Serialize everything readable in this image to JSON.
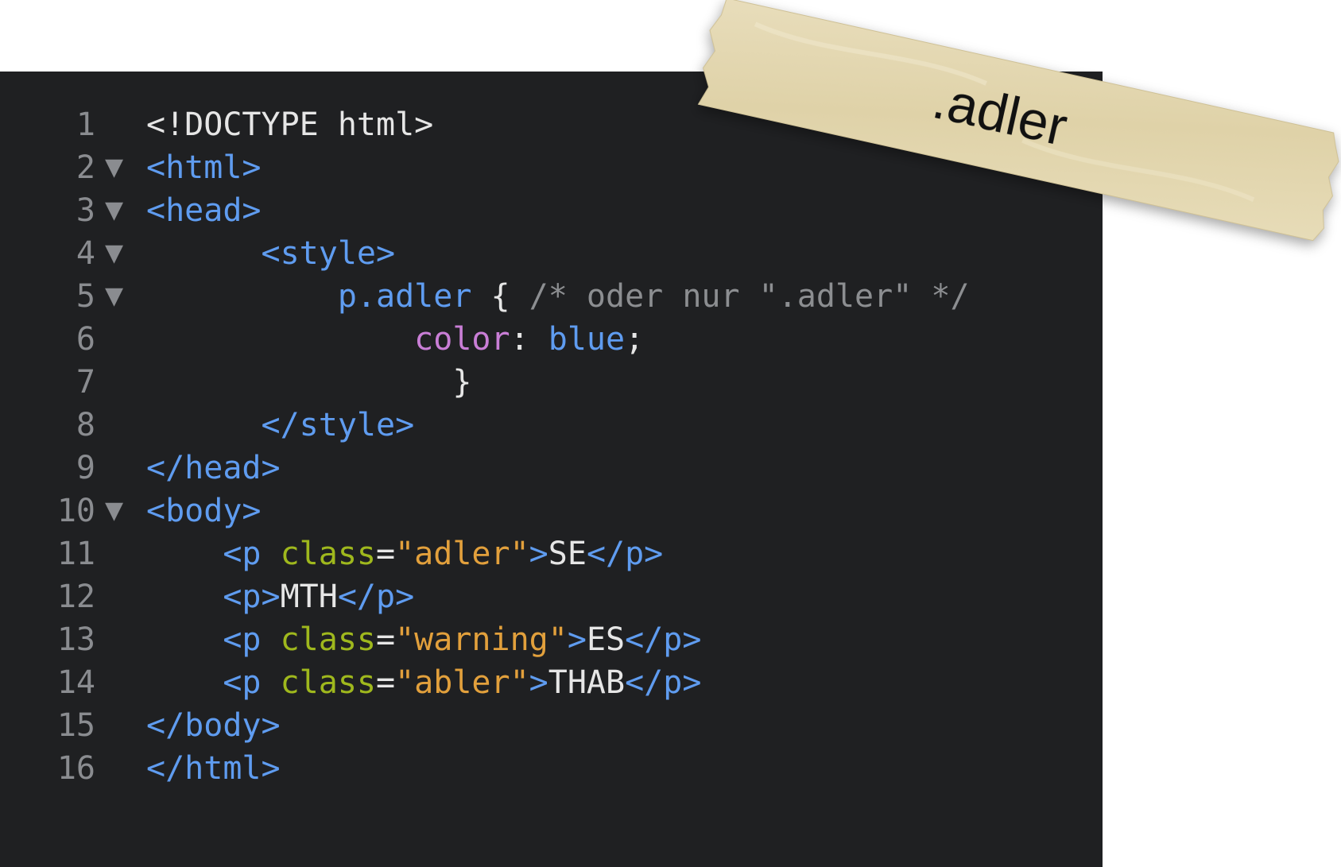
{
  "editor": {
    "lines": [
      {
        "num": "1",
        "fold": "",
        "tokens": [
          {
            "t": "<!DOCTYPE html>",
            "c": "plain"
          }
        ]
      },
      {
        "num": "2",
        "fold": "▼",
        "tokens": [
          {
            "t": "<html>",
            "c": "tag"
          }
        ]
      },
      {
        "num": "3",
        "fold": "▼",
        "tokens": [
          {
            "t": "<head>",
            "c": "tag"
          }
        ]
      },
      {
        "num": "4",
        "fold": "▼",
        "tokens": [
          {
            "t": "      ",
            "c": "plain"
          },
          {
            "t": "<style>",
            "c": "tag"
          }
        ]
      },
      {
        "num": "5",
        "fold": "▼",
        "tokens": [
          {
            "t": "          ",
            "c": "plain"
          },
          {
            "t": "p.adler",
            "c": "tag"
          },
          {
            "t": " { ",
            "c": "plain"
          },
          {
            "t": "/* oder nur \".adler\" */",
            "c": "cmt"
          }
        ]
      },
      {
        "num": "6",
        "fold": "",
        "tokens": [
          {
            "t": "              ",
            "c": "plain"
          },
          {
            "t": "color",
            "c": "prop"
          },
          {
            "t": ": ",
            "c": "plain"
          },
          {
            "t": "blue",
            "c": "val"
          },
          {
            "t": ";",
            "c": "plain"
          }
        ]
      },
      {
        "num": "7",
        "fold": "",
        "tokens": [
          {
            "t": "                ",
            "c": "plain"
          },
          {
            "t": "}",
            "c": "plain"
          }
        ]
      },
      {
        "num": "8",
        "fold": "",
        "tokens": [
          {
            "t": "      ",
            "c": "plain"
          },
          {
            "t": "</style>",
            "c": "tag"
          }
        ]
      },
      {
        "num": "9",
        "fold": "",
        "tokens": [
          {
            "t": "</head>",
            "c": "tag"
          }
        ]
      },
      {
        "num": "10",
        "fold": "▼",
        "tokens": [
          {
            "t": "<body>",
            "c": "tag"
          }
        ]
      },
      {
        "num": "11",
        "fold": "",
        "tokens": [
          {
            "t": "    ",
            "c": "plain"
          },
          {
            "t": "<p ",
            "c": "tag"
          },
          {
            "t": "class",
            "c": "attr"
          },
          {
            "t": "=",
            "c": "plain"
          },
          {
            "t": "\"adler\"",
            "c": "str"
          },
          {
            "t": ">",
            "c": "tag"
          },
          {
            "t": "SE",
            "c": "plain"
          },
          {
            "t": "</p>",
            "c": "tag"
          }
        ]
      },
      {
        "num": "12",
        "fold": "",
        "tokens": [
          {
            "t": "    ",
            "c": "plain"
          },
          {
            "t": "<p>",
            "c": "tag"
          },
          {
            "t": "MTH",
            "c": "plain"
          },
          {
            "t": "</p>",
            "c": "tag"
          }
        ]
      },
      {
        "num": "13",
        "fold": "",
        "tokens": [
          {
            "t": "    ",
            "c": "plain"
          },
          {
            "t": "<p ",
            "c": "tag"
          },
          {
            "t": "class",
            "c": "attr"
          },
          {
            "t": "=",
            "c": "plain"
          },
          {
            "t": "\"warning\"",
            "c": "str"
          },
          {
            "t": ">",
            "c": "tag"
          },
          {
            "t": "ES",
            "c": "plain"
          },
          {
            "t": "</p>",
            "c": "tag"
          }
        ]
      },
      {
        "num": "14",
        "fold": "",
        "tokens": [
          {
            "t": "    ",
            "c": "plain"
          },
          {
            "t": "<p ",
            "c": "tag"
          },
          {
            "t": "class",
            "c": "attr"
          },
          {
            "t": "=",
            "c": "plain"
          },
          {
            "t": "\"abler\"",
            "c": "str"
          },
          {
            "t": ">",
            "c": "tag"
          },
          {
            "t": "THAB",
            "c": "plain"
          },
          {
            "t": "</p>",
            "c": "tag"
          }
        ]
      },
      {
        "num": "15",
        "fold": "",
        "tokens": [
          {
            "t": "</body>",
            "c": "tag"
          }
        ]
      },
      {
        "num": "16",
        "fold": "",
        "tokens": [
          {
            "t": "</html>",
            "c": "tag"
          }
        ]
      }
    ]
  },
  "tape": {
    "label": ".adler",
    "color": "#e4d8b2"
  }
}
